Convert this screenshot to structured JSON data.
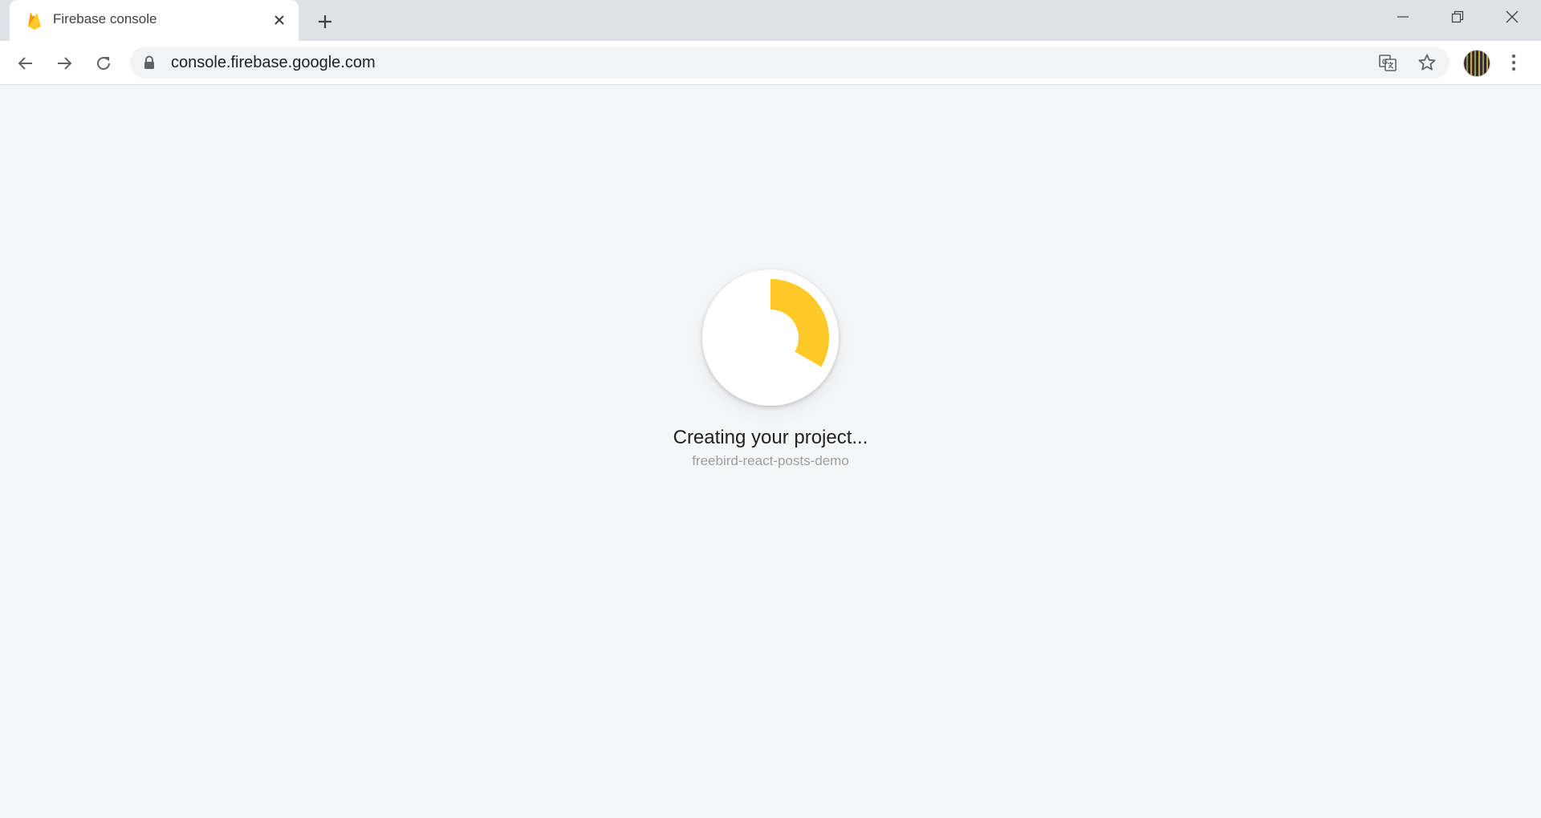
{
  "tab": {
    "title": "Firebase console",
    "favicon": "firebase-flame-icon"
  },
  "window": {
    "controls": [
      "minimize-icon",
      "restore-icon",
      "close-icon"
    ]
  },
  "toolbar": {
    "url": "console.firebase.google.com"
  },
  "main": {
    "status_title": "Creating your project...",
    "project_name": "freebird-react-posts-demo",
    "progress_color": "#ffca28"
  },
  "colors": {
    "tabstrip": "#dee1e6",
    "page_background": "#f5f6f8",
    "accent": "#ffca28"
  }
}
